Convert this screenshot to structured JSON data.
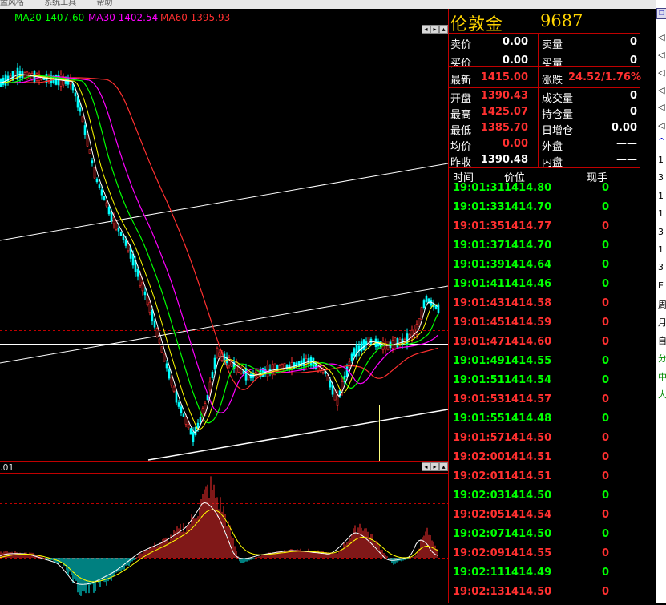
{
  "window": {
    "menu_items": [
      "盘风格",
      "系统工具",
      "帮助"
    ]
  },
  "chart": {
    "ma_legend": [
      {
        "label": "MA20 1407.60",
        "color": "#00ff00"
      },
      {
        "label": "MA30 1402.54",
        "color": "#ff00ff"
      },
      {
        "label": "MA60 1395.93",
        "color": "#ff3030"
      }
    ],
    "sub_label": ".01",
    "colors": {
      "up": "#ff3030",
      "down": "#00ffff",
      "ma5": "#ffffff",
      "ma10": "#ffff00",
      "ma20": "#00ff00",
      "ma30": "#ff00ff",
      "ma60": "#ff3030",
      "vol": "#ffff80"
    }
  },
  "quote": {
    "name": "伦敦金",
    "code": "9687",
    "rows": [
      {
        "l1": "卖价",
        "v1": "0.00",
        "c1": "#ffffff",
        "l2": "卖量",
        "v2": "0",
        "c2": "#ffffff"
      },
      {
        "l1": "买价",
        "v1": "0.00",
        "c1": "#ffffff",
        "l2": "买量",
        "v2": "0",
        "c2": "#ffffff"
      },
      {
        "l1": "最新",
        "v1": "1415.00",
        "c1": "#ff3030",
        "l2": "涨跌",
        "v2": "24.52/1.76%",
        "c2": "#ff3030"
      },
      {
        "l1": "开盘",
        "v1": "1390.43",
        "c1": "#ff3030",
        "l2": "成交量",
        "v2": "0",
        "c2": "#ffffff"
      },
      {
        "l1": "最高",
        "v1": "1425.07",
        "c1": "#ff3030",
        "l2": "持仓量",
        "v2": "0",
        "c2": "#ffffff"
      },
      {
        "l1": "最低",
        "v1": "1385.70",
        "c1": "#ff3030",
        "l2": "日增仓",
        "v2": "0.00",
        "c2": "#ffffff"
      },
      {
        "l1": "均价",
        "v1": "0.00",
        "c1": "#ff3030",
        "l2": "外盘",
        "v2": "——",
        "c2": "#ffffff"
      },
      {
        "l1": "昨收",
        "v1": "1390.48",
        "c1": "#ffffff",
        "l2": "内盘",
        "v2": "——",
        "c2": "#ffffff"
      }
    ],
    "tick_headers": {
      "time": "时间",
      "price": "价位",
      "qty": "现手"
    },
    "ticks": [
      {
        "time": "19:01:31",
        "price": "1414.80",
        "qty": "0",
        "color": "#00ff00"
      },
      {
        "time": "19:01:33",
        "price": "1414.70",
        "qty": "0",
        "color": "#00ff00"
      },
      {
        "time": "19:01:35",
        "price": "1414.77",
        "qty": "0",
        "color": "#ff3030"
      },
      {
        "time": "19:01:37",
        "price": "1414.70",
        "qty": "0",
        "color": "#00ff00"
      },
      {
        "time": "19:01:39",
        "price": "1414.64",
        "qty": "0",
        "color": "#00ff00"
      },
      {
        "time": "19:01:41",
        "price": "1414.46",
        "qty": "0",
        "color": "#00ff00"
      },
      {
        "time": "19:01:43",
        "price": "1414.58",
        "qty": "0",
        "color": "#ff3030"
      },
      {
        "time": "19:01:45",
        "price": "1414.59",
        "qty": "0",
        "color": "#ff3030"
      },
      {
        "time": "19:01:47",
        "price": "1414.60",
        "qty": "0",
        "color": "#ff3030"
      },
      {
        "time": "19:01:49",
        "price": "1414.55",
        "qty": "0",
        "color": "#00ff00"
      },
      {
        "time": "19:01:51",
        "price": "1414.54",
        "qty": "0",
        "color": "#00ff00"
      },
      {
        "time": "19:01:53",
        "price": "1414.57",
        "qty": "0",
        "color": "#ff3030"
      },
      {
        "time": "19:01:55",
        "price": "1414.48",
        "qty": "0",
        "color": "#00ff00"
      },
      {
        "time": "19:01:57",
        "price": "1414.50",
        "qty": "0",
        "color": "#ff3030"
      },
      {
        "time": "19:02:00",
        "price": "1414.51",
        "qty": "0",
        "color": "#ff3030"
      },
      {
        "time": "19:02:01",
        "price": "1414.51",
        "qty": "0",
        "color": "#ff3030"
      },
      {
        "time": "19:02:03",
        "price": "1414.50",
        "qty": "0",
        "color": "#00ff00"
      },
      {
        "time": "19:02:05",
        "price": "1414.54",
        "qty": "0",
        "color": "#ff3030"
      },
      {
        "time": "19:02:07",
        "price": "1414.50",
        "qty": "0",
        "color": "#00ff00"
      },
      {
        "time": "19:02:09",
        "price": "1414.55",
        "qty": "0",
        "color": "#ff3030"
      },
      {
        "time": "19:02:11",
        "price": "1414.49",
        "qty": "0",
        "color": "#00ff00"
      },
      {
        "time": "19:02:13",
        "price": "1414.50",
        "qty": "0",
        "color": "#ff3030"
      }
    ]
  },
  "sidebar": {
    "items": [
      "◁",
      "◁",
      "◁",
      "◁",
      "◁",
      "◁",
      "^",
      "1",
      "3",
      "1",
      "1",
      "3",
      "1",
      "3",
      "E",
      "周",
      "月",
      "自",
      "分",
      "中",
      "大"
    ]
  }
}
